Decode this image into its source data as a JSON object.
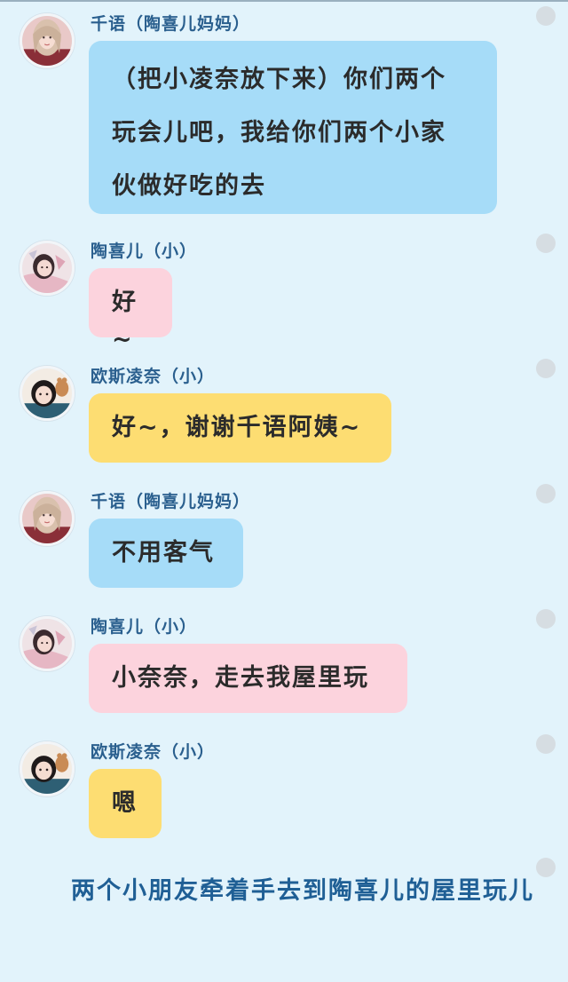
{
  "messages": [
    {
      "sender": "千语（陶喜儿妈妈）",
      "avatar_icon": "avatar-qianyu-icon",
      "text_lines": [
        "（把小凌奈放下来）你们两个",
        "玩会儿吧，我给你们两个小家",
        "伙做好吃的去"
      ],
      "color": "#a6dcf8"
    },
    {
      "sender": "陶喜儿（小）",
      "avatar_icon": "avatar-taoxier-icon",
      "text": "好~",
      "color": "#fcd3dd"
    },
    {
      "sender": "欧斯凌奈（小）",
      "avatar_icon": "avatar-ousilingnai-icon",
      "text": "好~，谢谢千语阿姨~",
      "color": "#fddd72"
    },
    {
      "sender": "千语（陶喜儿妈妈）",
      "avatar_icon": "avatar-qianyu-icon",
      "text": "不用客气",
      "color": "#a6dcf8"
    },
    {
      "sender": "陶喜儿（小）",
      "avatar_icon": "avatar-taoxier-icon",
      "text": "小奈奈，走去我屋里玩",
      "color": "#fcd3dd"
    },
    {
      "sender": "欧斯凌奈（小）",
      "avatar_icon": "avatar-ousilingnai-icon",
      "text": "嗯",
      "color": "#fddd72"
    }
  ],
  "narration": "两个小朋友牵着手去到陶喜儿的屋里玩儿",
  "colors": {
    "background": "#e2f3fb",
    "name_text": "#2a5f8e",
    "narration_text": "#1f5f95",
    "dot": "#d6dde2"
  }
}
